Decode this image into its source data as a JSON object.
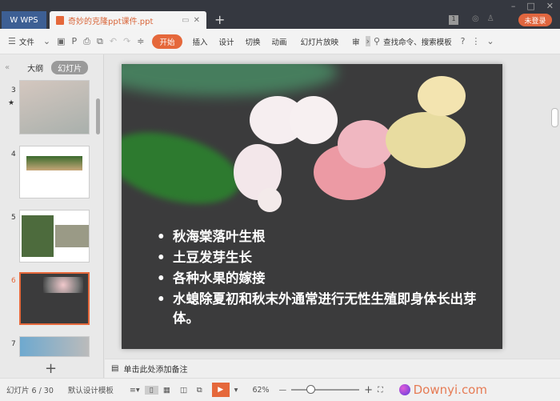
{
  "titlebar": {
    "app": "WPS",
    "doc_tab": "奇妙的克隆ppt课件.ppt",
    "login": "未登录",
    "badge": "1"
  },
  "toolbar": {
    "file": "文件",
    "tabs": [
      "开始",
      "插入",
      "设计",
      "切换",
      "动画",
      "幻灯片放映",
      "审"
    ],
    "search": "查找命令、搜索模板",
    "help": "?"
  },
  "panel": {
    "outline": "大纲",
    "slides": "幻灯片",
    "thumb_numbers": [
      "3",
      "4",
      "5",
      "6",
      "7"
    ],
    "current": "6"
  },
  "slide": {
    "bullets": [
      "秋海棠落叶生根",
      "土豆发芽生长",
      "各种水果的嫁接",
      "水螅除夏初和秋末外通常进行无性生殖即身体长出芽体。"
    ]
  },
  "notes": {
    "placeholder": "单击此处添加备注"
  },
  "status": {
    "slide_counter": "幻灯片 6 / 30",
    "template": "默认设计模板",
    "zoom": "62%",
    "zoom_level_fraction": 0.22,
    "watermark": "Downyi.com"
  },
  "colors": {
    "accent": "#e5683b",
    "titlebar": "#353840",
    "slide_bg": "#3b3b3c"
  }
}
